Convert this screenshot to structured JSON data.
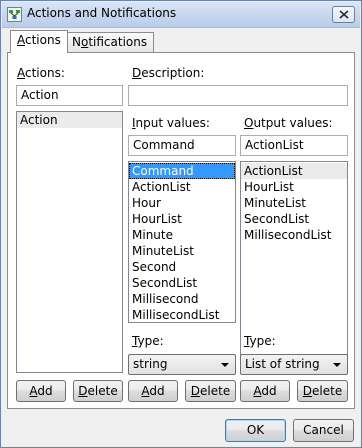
{
  "window": {
    "title": "Actions and Notifications",
    "app_icon": "flow-diagram-icon",
    "close_icon": "close-icon"
  },
  "tabs": [
    {
      "label_pre": "",
      "mnemonic": "A",
      "label_post": "ctions",
      "active": true
    },
    {
      "label_pre": "N",
      "mnemonic": "o",
      "label_post": "tifications",
      "active": false
    }
  ],
  "actions": {
    "label_mnemonic": "A",
    "label_rest": "ctions:",
    "name_value": "Action",
    "items": [
      "Action"
    ],
    "selected": 0
  },
  "description": {
    "label_mnemonic": "D",
    "label_rest": "escription:",
    "value": ""
  },
  "input_values": {
    "label_mnemonic": "I",
    "label_rest": "nput values:",
    "name_value": "Command",
    "items": [
      "Command",
      "ActionList",
      "Hour",
      "HourList",
      "Minute",
      "MinuteList",
      "Second",
      "SecondList",
      "Millisecond",
      "MillisecondList"
    ],
    "selected": 0,
    "type_label_mnemonic": "T",
    "type_label_rest": "ype:",
    "type_value": "string"
  },
  "output_values": {
    "label_mnemonic": "O",
    "label_rest": "utput values:",
    "name_value": "ActionList",
    "items": [
      "ActionList",
      "HourList",
      "MinuteList",
      "SecondList",
      "MillisecondList"
    ],
    "selected": 0,
    "type_label_mnemonic": "T",
    "type_label_rest": "ype:",
    "type_value": "List of string"
  },
  "buttons": {
    "add": "Add",
    "add_mnemonic": "A",
    "add_rest": "dd",
    "delete": "Delete",
    "delete_mnemonic": "D",
    "delete_rest": "elete",
    "ok": "OK",
    "cancel": "Cancel"
  }
}
